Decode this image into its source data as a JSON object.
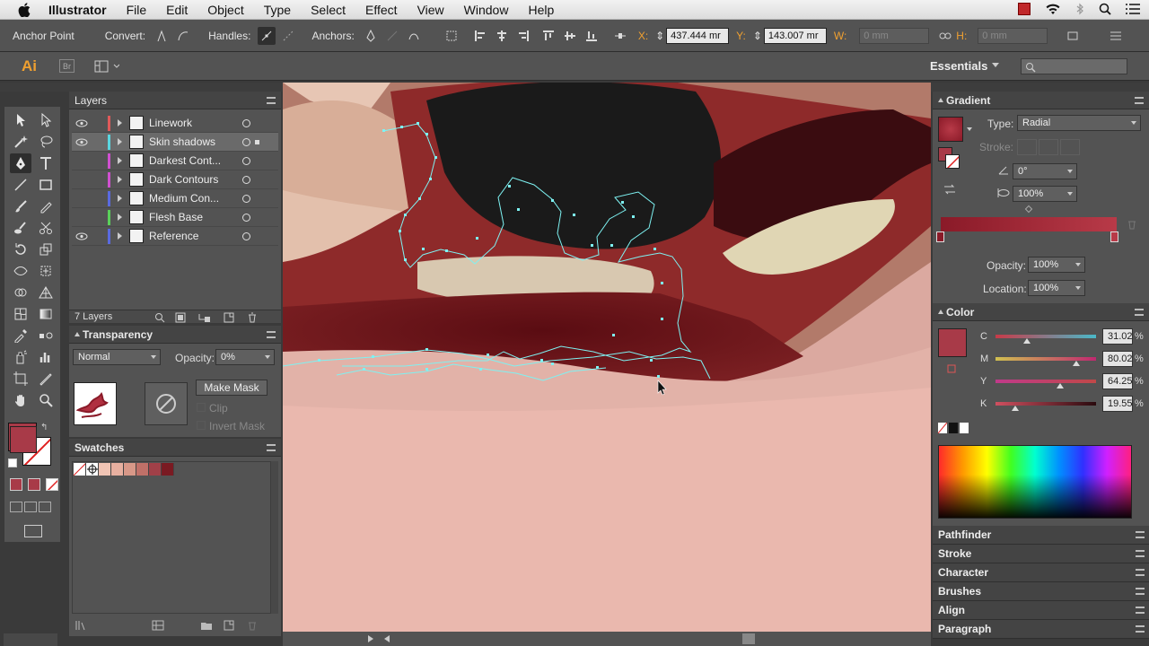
{
  "menubar": {
    "app": "Illustrator",
    "items": [
      "File",
      "Edit",
      "Object",
      "Type",
      "Select",
      "Effect",
      "View",
      "Window",
      "Help"
    ]
  },
  "control": {
    "tool_label": "Anchor Point",
    "convert_label": "Convert:",
    "handles_label": "Handles:",
    "anchors_label": "Anchors:",
    "x_label": "X:",
    "x_value": "437.444 mr",
    "y_label": "Y:",
    "y_value": "143.007 mr",
    "w_label": "W:",
    "w_value": "0 mm",
    "h_label": "H:",
    "h_value": "0 mm"
  },
  "appbar": {
    "logo": "Ai",
    "bridge": "Br",
    "workspace": "Essentials",
    "search_placeholder": ""
  },
  "layers": {
    "title": "Layers",
    "rows": [
      {
        "name": "Linework",
        "color": "#e05a5a",
        "visible": true
      },
      {
        "name": "Skin shadows",
        "color": "#5ad6e0",
        "visible": true
      },
      {
        "name": "Darkest Cont...",
        "color": "#d050d0",
        "visible": false
      },
      {
        "name": "Dark Contours",
        "color": "#d050d0",
        "visible": false
      },
      {
        "name": "Medium Con...",
        "color": "#5a6ae0",
        "visible": false
      },
      {
        "name": "Flesh Base",
        "color": "#5ad05a",
        "visible": false
      },
      {
        "name": "Reference",
        "color": "#5a6ae0",
        "visible": true
      }
    ],
    "count": "7 Layers"
  },
  "transparency": {
    "title": "Transparency",
    "blend_mode": "Normal",
    "opacity_label": "Opacity:",
    "opacity": "0%",
    "make_mask": "Make Mask",
    "clip": "Clip",
    "invert_mask": "Invert Mask"
  },
  "swatches": {
    "title": "Swatches",
    "colors": [
      "#f0c4b4",
      "#e8b0a0",
      "#d89888",
      "#c07068",
      "#a04048",
      "#7a1a22"
    ]
  },
  "gradient": {
    "title": "Gradient",
    "type_label": "Type:",
    "type": "Radial",
    "stroke_label": "Stroke:",
    "angle": "0°",
    "aspect": "100%",
    "opacity_label": "Opacity:",
    "opacity": "100%",
    "location_label": "Location:",
    "location": "100%",
    "start_color": "#8a1a28",
    "end_color": "#b83a48"
  },
  "color": {
    "title": "Color",
    "swatch": "#a83a48",
    "channels": [
      {
        "label": "C",
        "value": "31.02",
        "fraction": 0.31
      },
      {
        "label": "M",
        "value": "80.02",
        "fraction": 0.8
      },
      {
        "label": "Y",
        "value": "64.25",
        "fraction": 0.64
      },
      {
        "label": "K",
        "value": "19.55",
        "fraction": 0.2
      }
    ],
    "unit": "%"
  },
  "collapsed_panels": [
    "Pathfinder",
    "Stroke",
    "Character",
    "Brushes",
    "Align",
    "Paragraph"
  ]
}
